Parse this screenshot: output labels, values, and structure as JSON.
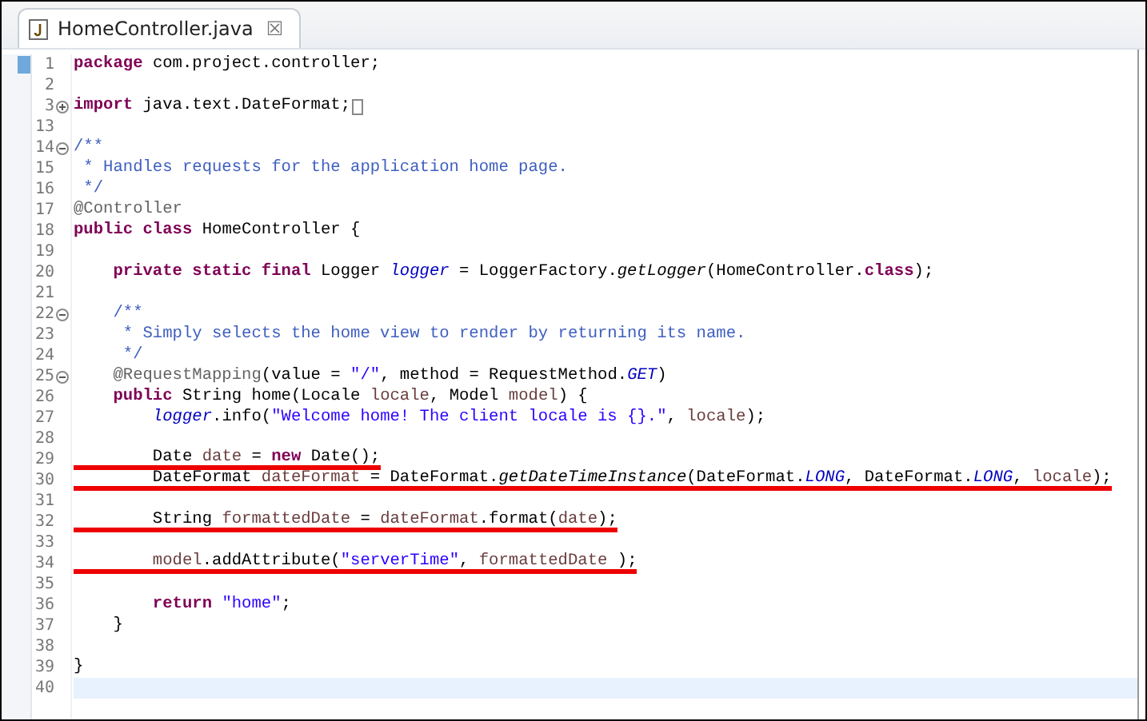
{
  "tab": {
    "title": "HomeController.java",
    "selected": true,
    "close_label": "☒"
  },
  "lines": [
    {
      "number": "1",
      "ruler_mark": true,
      "tokens": [
        {
          "kind": "keyword",
          "text": "package"
        },
        {
          "kind": "plain",
          "text": " com.project.controller;"
        }
      ]
    },
    {
      "number": "2"
    },
    {
      "number": "3",
      "foldable": true,
      "expanded": false,
      "folded_box": true,
      "tokens": [
        {
          "kind": "keyword",
          "text": "import"
        },
        {
          "kind": "plain",
          "text": " java.text.DateFormat;"
        }
      ]
    },
    {
      "number": "13"
    },
    {
      "number": "14",
      "foldable": true,
      "expanded": true,
      "tokens": [
        {
          "kind": "comment",
          "text": "/**"
        }
      ]
    },
    {
      "number": "15",
      "tokens": [
        {
          "kind": "comment",
          "text": " * Handles requests for the application home page."
        }
      ]
    },
    {
      "number": "16",
      "tokens": [
        {
          "kind": "comment",
          "text": " */"
        }
      ]
    },
    {
      "number": "17",
      "tokens": [
        {
          "kind": "annotation",
          "text": "@Controller"
        }
      ]
    },
    {
      "number": "18",
      "tokens": [
        {
          "kind": "keyword",
          "text": "public class"
        },
        {
          "kind": "plain",
          "text": " HomeController {"
        }
      ]
    },
    {
      "number": "19"
    },
    {
      "number": "20",
      "tokens": [
        {
          "kind": "keyword",
          "text": "    private static final"
        },
        {
          "kind": "plain",
          "text": " Logger "
        },
        {
          "kind": "field",
          "text": "logger"
        },
        {
          "kind": "plain",
          "text": " = LoggerFactory."
        },
        {
          "kind": "static_method",
          "text": "getLogger"
        },
        {
          "kind": "plain",
          "text": "(HomeController."
        },
        {
          "kind": "keyword",
          "text": "class"
        },
        {
          "kind": "plain",
          "text": ");"
        }
      ]
    },
    {
      "number": "21"
    },
    {
      "number": "22",
      "foldable": true,
      "expanded": true,
      "tokens": [
        {
          "kind": "comment",
          "text": "    /**"
        }
      ]
    },
    {
      "number": "23",
      "tokens": [
        {
          "kind": "comment",
          "text": "     * Simply selects the home view to render by returning its name."
        }
      ]
    },
    {
      "number": "24",
      "tokens": [
        {
          "kind": "comment",
          "text": "     */"
        }
      ]
    },
    {
      "number": "25",
      "foldable": true,
      "expanded": true,
      "tokens": [
        {
          "kind": "annotation",
          "text": "    @RequestMapping"
        },
        {
          "kind": "plain",
          "text": "(value = "
        },
        {
          "kind": "string",
          "text": "\"/\""
        },
        {
          "kind": "plain",
          "text": ", method = RequestMethod."
        },
        {
          "kind": "field",
          "text": "GET"
        },
        {
          "kind": "plain",
          "text": ")"
        }
      ]
    },
    {
      "number": "26",
      "tokens": [
        {
          "kind": "keyword",
          "text": "    public"
        },
        {
          "kind": "plain",
          "text": " String home(Locale "
        },
        {
          "kind": "variable",
          "text": "locale"
        },
        {
          "kind": "plain",
          "text": ", Model "
        },
        {
          "kind": "variable",
          "text": "model"
        },
        {
          "kind": "plain",
          "text": ") {"
        }
      ]
    },
    {
      "number": "27",
      "tokens": [
        {
          "kind": "field",
          "text": "        logger"
        },
        {
          "kind": "plain",
          "text": ".info("
        },
        {
          "kind": "string",
          "text": "\"Welcome home! The client locale is {}.\""
        },
        {
          "kind": "plain",
          "text": ", "
        },
        {
          "kind": "variable",
          "text": "locale"
        },
        {
          "kind": "plain",
          "text": ");"
        }
      ]
    },
    {
      "number": "28"
    },
    {
      "number": "29",
      "underlined": true,
      "tokens": [
        {
          "kind": "plain",
          "text": "        Date "
        },
        {
          "kind": "variable",
          "text": "date"
        },
        {
          "kind": "plain",
          "text": " = "
        },
        {
          "kind": "keyword",
          "text": "new"
        },
        {
          "kind": "plain",
          "text": " Date();"
        }
      ]
    },
    {
      "number": "30",
      "underlined": true,
      "tokens": [
        {
          "kind": "plain",
          "text": "        DateFormat "
        },
        {
          "kind": "variable",
          "text": "dateFormat"
        },
        {
          "kind": "plain",
          "text": " = DateFormat."
        },
        {
          "kind": "static_method",
          "text": "getDateTimeInstance"
        },
        {
          "kind": "plain",
          "text": "(DateFormat."
        },
        {
          "kind": "field",
          "text": "LONG"
        },
        {
          "kind": "plain",
          "text": ", DateFormat."
        },
        {
          "kind": "field",
          "text": "LONG"
        },
        {
          "kind": "plain",
          "text": ", "
        },
        {
          "kind": "variable",
          "text": "locale"
        },
        {
          "kind": "plain",
          "text": ");"
        }
      ]
    },
    {
      "number": "31"
    },
    {
      "number": "32",
      "underlined": true,
      "tokens": [
        {
          "kind": "plain",
          "text": "        String "
        },
        {
          "kind": "variable",
          "text": "formattedDate"
        },
        {
          "kind": "plain",
          "text": " = "
        },
        {
          "kind": "variable",
          "text": "dateFormat"
        },
        {
          "kind": "plain",
          "text": ".format("
        },
        {
          "kind": "variable",
          "text": "date"
        },
        {
          "kind": "plain",
          "text": ");"
        }
      ]
    },
    {
      "number": "33"
    },
    {
      "number": "34",
      "underlined": true,
      "tokens": [
        {
          "kind": "variable",
          "text": "        model"
        },
        {
          "kind": "plain",
          "text": ".addAttribute("
        },
        {
          "kind": "string",
          "text": "\"serverTime\""
        },
        {
          "kind": "plain",
          "text": ", "
        },
        {
          "kind": "variable",
          "text": "formattedDate"
        },
        {
          "kind": "plain",
          "text": " );"
        }
      ]
    },
    {
      "number": "35"
    },
    {
      "number": "36",
      "tokens": [
        {
          "kind": "keyword",
          "text": "        return "
        },
        {
          "kind": "string",
          "text": "\"home\""
        },
        {
          "kind": "plain",
          "text": ";"
        }
      ]
    },
    {
      "number": "37",
      "tokens": [
        {
          "kind": "plain",
          "text": "    }"
        }
      ]
    },
    {
      "number": "38"
    },
    {
      "number": "39",
      "tokens": [
        {
          "kind": "plain",
          "text": "}"
        }
      ]
    },
    {
      "number": "40",
      "current": true
    }
  ]
}
